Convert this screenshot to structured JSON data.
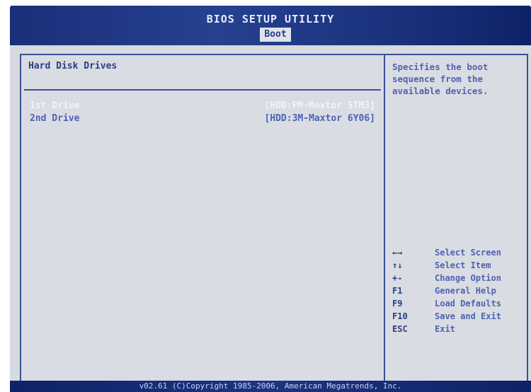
{
  "header": {
    "title": "BIOS SETUP UTILITY",
    "active_tab": "Boot"
  },
  "main": {
    "section_title": "Hard Disk Drives",
    "rows": [
      {
        "label": "1st Drive",
        "value": "[HDD:PM-Maxtor STM3]"
      },
      {
        "label": "2nd Drive",
        "value": "[HDD:3M-Maxtor 6Y06]"
      }
    ]
  },
  "help": {
    "text": "Specifies the boot sequence from the available devices.",
    "keys": [
      {
        "key": "←→",
        "desc": "Select Screen"
      },
      {
        "key": "↑↓",
        "desc": "Select Item"
      },
      {
        "key": "+-",
        "desc": "Change Option"
      },
      {
        "key": "F1",
        "desc": "General Help"
      },
      {
        "key": "F9",
        "desc": "Load Defaults"
      },
      {
        "key": "F10",
        "desc": "Save and Exit"
      },
      {
        "key": "ESC",
        "desc": "Exit"
      }
    ]
  },
  "footer": {
    "text": "v02.61 (C)Copyright 1985-2006, American Megatrends, Inc."
  },
  "colors": {
    "header_blue": "#1c347f",
    "panel_bg": "#d9dce3",
    "border_blue": "#3a5198",
    "selected_text": "#f0f3fa",
    "normal_text": "#4f63b0"
  }
}
